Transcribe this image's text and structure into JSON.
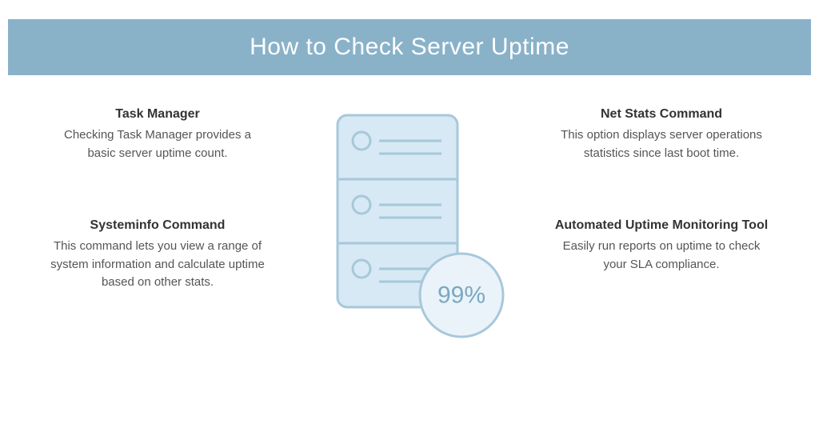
{
  "title": "How to Check Server Uptime",
  "left": {
    "top": {
      "heading": "Task Manager",
      "body": "Checking Task Manager provides a basic server uptime count."
    },
    "bottom": {
      "heading": "Systeminfo Command",
      "body": "This command lets you view a range of system information and calculate uptime based on other stats."
    }
  },
  "right": {
    "top": {
      "heading": "Net Stats Command",
      "body": "This option displays server operations statistics since last boot time."
    },
    "bottom": {
      "heading": "Automated Uptime Monitoring Tool",
      "body": "Easily run reports on uptime to check your SLA compliance."
    }
  },
  "graphic": {
    "badge": "99%"
  },
  "colors": {
    "banner_bg": "#89b2c9",
    "server_fill": "#d6e9f4",
    "server_stroke": "#a8c8da",
    "circle_fill": "#eaf3f9",
    "badge_text": "#7aa8c2"
  }
}
